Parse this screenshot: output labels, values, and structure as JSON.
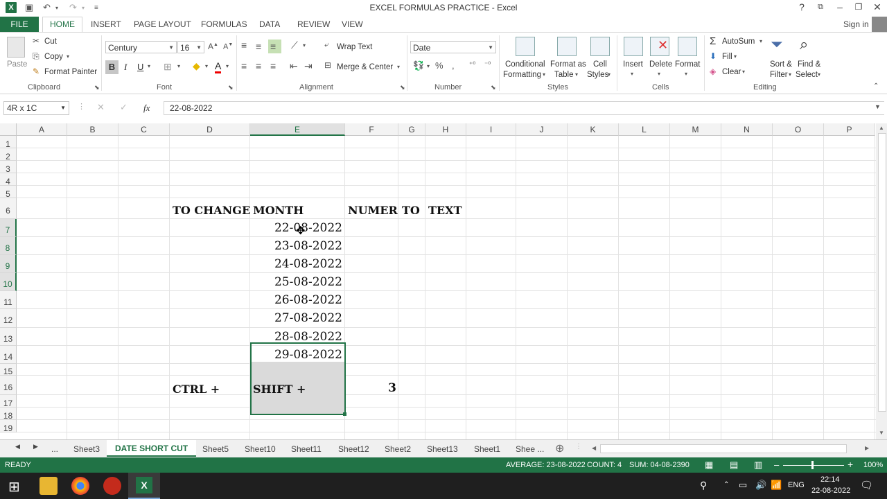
{
  "window": {
    "title": "EXCEL FORMULAS PRACTICE - Excel",
    "sign_in": "Sign in",
    "help": "?"
  },
  "tabs": [
    "FILE",
    "HOME",
    "INSERT",
    "PAGE LAYOUT",
    "FORMULAS",
    "DATA",
    "REVIEW",
    "VIEW"
  ],
  "ribbon": {
    "clipboard": {
      "paste": "Paste",
      "cut": "Cut",
      "copy": "Copy",
      "format_painter": "Format Painter",
      "label": "Clipboard"
    },
    "font": {
      "name": "Century",
      "size": "16",
      "label": "Font",
      "bold": "B",
      "italic": "I",
      "underline": "U"
    },
    "alignment": {
      "wrap": "Wrap Text",
      "merge": "Merge & Center",
      "label": "Alignment"
    },
    "number": {
      "format": "Date",
      "label": "Number"
    },
    "styles": {
      "conditional": "Conditional",
      "conditional2": "Formatting",
      "format_as": "Format as",
      "format_as2": "Table",
      "cell": "Cell",
      "cell2": "Styles",
      "label": "Styles"
    },
    "cells": {
      "insert": "Insert",
      "delete": "Delete",
      "format": "Format",
      "label": "Cells"
    },
    "editing": {
      "autosum": "AutoSum",
      "fill": "Fill",
      "clear": "Clear",
      "sort": "Sort &",
      "sort2": "Filter",
      "find": "Find &",
      "find2": "Select",
      "label": "Editing"
    }
  },
  "formula_bar": {
    "name_box": "4R x 1C",
    "fx": "fx",
    "value": "22-08-2022"
  },
  "columns": [
    "A",
    "B",
    "C",
    "D",
    "E",
    "F",
    "G",
    "H",
    "I",
    "J",
    "K",
    "L",
    "M",
    "N",
    "O",
    "P"
  ],
  "rows": [
    "1",
    "2",
    "3",
    "4",
    "5",
    "6",
    "7",
    "8",
    "9",
    "10",
    "11",
    "12",
    "13",
    "14",
    "15",
    "16",
    "17",
    "18",
    "19"
  ],
  "cells": {
    "d6": "TO CHANGE",
    "e6": "MONTH",
    "f6": "NUMER",
    "g6": "TO",
    "h6": "TEXT",
    "dates": [
      "22-08-2022",
      "23-08-2022",
      "24-08-2022",
      "25-08-2022",
      "26-08-2022",
      "27-08-2022",
      "28-08-2022",
      "29-08-2022"
    ],
    "d16": "CTRL +",
    "e16": "SHIFT +",
    "f16": "3"
  },
  "sheets": [
    "...",
    "Sheet3",
    "DATE SHORT CUT",
    "Sheet5",
    "Sheet10",
    "Sheet11",
    "Sheet12",
    "Sheet2",
    "Sheet13",
    "Sheet1",
    "Shee ..."
  ],
  "status": {
    "ready": "READY",
    "average": "AVERAGE: 23-08-2022",
    "count": "COUNT: 4",
    "sum": "SUM: 04-08-2390",
    "zoom": "100%"
  },
  "taskbar": {
    "lang": "ENG",
    "time": "22:14",
    "date": "22-08-2022"
  },
  "colors": {
    "excel_green": "#217346",
    "selection": "#dadada"
  }
}
